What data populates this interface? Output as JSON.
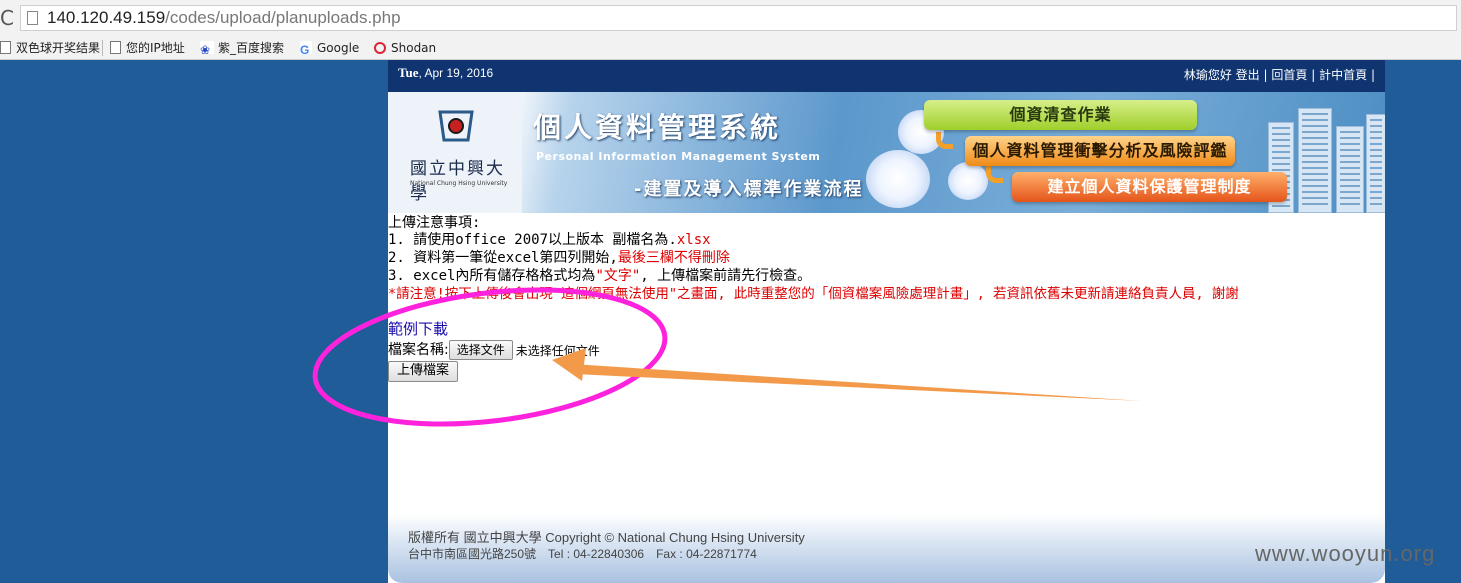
{
  "browser": {
    "url_host": "140.120.49.159",
    "url_path": "/codes/upload/planuploads.php",
    "bookmarks": [
      {
        "label": "双色球开奖结果"
      },
      {
        "label": "您的IP地址"
      },
      {
        "label": "紫_百度搜索"
      },
      {
        "label": "Google"
      },
      {
        "label": "Shodan"
      }
    ]
  },
  "header": {
    "date_day": "Tue",
    "date_rest": ", Apr 19, 2016",
    "links_text": [
      "林瑜您好",
      "登出",
      "|",
      "回首頁",
      "|",
      "計中首頁",
      "|"
    ]
  },
  "banner": {
    "university_cn": "國立中興大學",
    "university_en": "National Chung Hsing University",
    "system_title": "個人資料管理系統",
    "system_en": "Personal Information Management System",
    "system_sub": "-建置及導入標準作業流程",
    "pill1": "個資清查作業",
    "pill2": "個人資料管理衝擊分析及風險評鑑",
    "pill3": "建立個人資料保護管理制度"
  },
  "notice": {
    "heading": "上傳注意事項:",
    "item1_prefix": "1. 請使用office 2007以上版本 副檔名為.",
    "item1_ext": "xlsx",
    "item2_prefix": "2. 資料第一筆從excel第四列開始,",
    "item2_red": "最後三欄不得刪除",
    "item3_prefix": "3. excel內所有儲存格格式均為",
    "item3_red": "\"文字\"",
    "item3_suffix": ", 上傳檔案前請先行檢查。",
    "warning": "*請注意!按下上傳後會出現\"這個網頁無法使用\"之畫面, 此時重整您的「個資檔案風險處理計畫」, 若資訊依舊未更新請連絡負責人員, 謝謝"
  },
  "form": {
    "sample_link": "範例下載",
    "file_label": "檔案名稱:",
    "choose_button": "选择文件",
    "no_file": "未选择任何文件",
    "upload_button": "上傳檔案"
  },
  "footer": {
    "line1": "版權所有 國立中興大學 Copyright © National Chung Hsing University",
    "line2": "台中市南區國光路250號　Tel : 04-22840306　Fax : 04-22871774"
  },
  "watermark": "www.wooyun.org",
  "colors": {
    "background": "#1f5c98",
    "header_bar": "#0f3470",
    "warning_red": "#dd0000",
    "annotation_magenta": "#ff22dd",
    "annotation_orange": "#f39a4a"
  },
  "icons": [
    "reload-icon",
    "page-icon",
    "baidu-paw-icon",
    "google-icon",
    "shodan-icon"
  ]
}
